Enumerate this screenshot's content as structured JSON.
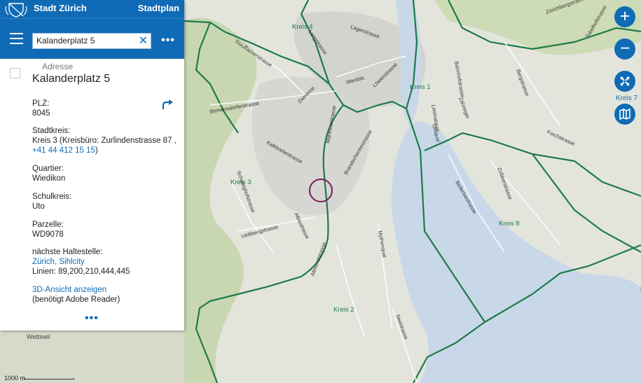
{
  "header": {
    "brand": "Stadt Zürich",
    "app_title": "Stadtplan"
  },
  "search": {
    "value": "Kalanderplatz 5",
    "placeholder": ""
  },
  "result": {
    "type_label": "Adresse",
    "title": "Kalanderplatz 5",
    "plz_label": "PLZ:",
    "plz": "8045",
    "stadtkreis_label": "Stadtkreis:",
    "stadtkreis_line1": "Kreis 3 (Kreisbüro: Zurlindenstrasse 87 ,",
    "stadtkreis_phone": "+41 44 412 15 15",
    "stadtkreis_close": ")",
    "quartier_label": "Quartier:",
    "quartier": "Wiedikon",
    "schulkreis_label": "Schulkreis:",
    "schulkreis": "Uto",
    "parzelle_label": "Parzelle:",
    "parzelle": "WD9078",
    "haltestelle_label": "nächste Haltestelle:",
    "haltestelle_link": "Zürich, Sihlcity",
    "linien": "Linien: 89,200,210,444,445",
    "view3d_link": "3D-Ansicht anzeigen",
    "view3d_note": "(benötigt Adobe Reader)"
  },
  "map": {
    "kreis_labels": [
      "Kreis 4",
      "Kreis 1",
      "Kreis 3",
      "Kreis 2",
      "Kreis 8"
    ],
    "side_label": "Kreis 7",
    "streets": [
      "Lagerstrasse",
      "Langstrasse",
      "Stauffacherstrasse",
      "Zweierstr.",
      "Birmensdorferstrasse",
      "Werdstr.",
      "Löwenstrasse",
      "Bahnhofstrasse",
      "Limmatquai",
      "Utoquai",
      "Zähringer",
      "Bergstrasse",
      "Forchstrasse",
      "Zollikerstrasse",
      "Mythenquai",
      "Seestrasse",
      "Allmendstrasse",
      "Uetlibergstrasse",
      "Schweighofstrasse",
      "Manessestrasse",
      "Bellerivestrasse",
      "Tobelhofstrasse",
      "Zürichbergstrasse",
      "Kalkbreitestrasse",
      "Brandschenkestrasse",
      "Albisstrasse"
    ],
    "place_label": "Wettswil",
    "scale_label": "1000 m"
  },
  "colors": {
    "brand_blue": "#0f6bb5",
    "boundary": "#1d7a4a",
    "lake": "#c9d8e8",
    "marker": "#7a1a5a"
  }
}
